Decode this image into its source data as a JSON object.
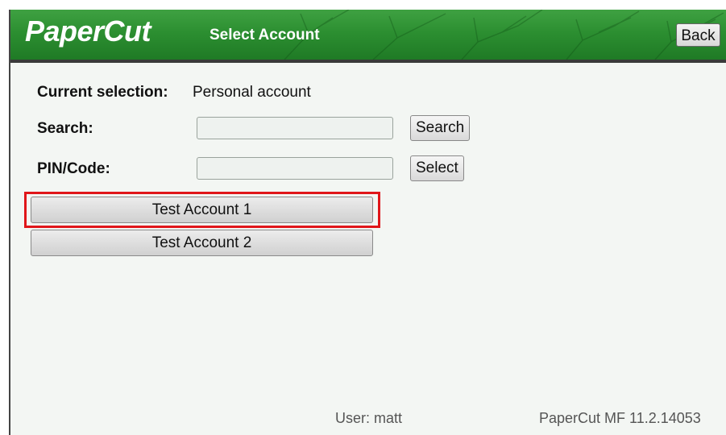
{
  "header": {
    "logo": "PaperCut",
    "title": "Select Account",
    "back_label": "Back"
  },
  "selection": {
    "label": "Current selection:",
    "value": "Personal account"
  },
  "search": {
    "label": "Search:",
    "value": "",
    "button_label": "Search"
  },
  "pin": {
    "label": "PIN/Code:",
    "value": "",
    "button_label": "Select"
  },
  "accounts": [
    {
      "label": "Test Account 1"
    },
    {
      "label": "Test Account 2"
    }
  ],
  "footer": {
    "user": "User: matt",
    "version": "PaperCut MF 11.2.14053"
  },
  "colors": {
    "header_green": "#2c8f31",
    "highlight": "#e0161a"
  }
}
